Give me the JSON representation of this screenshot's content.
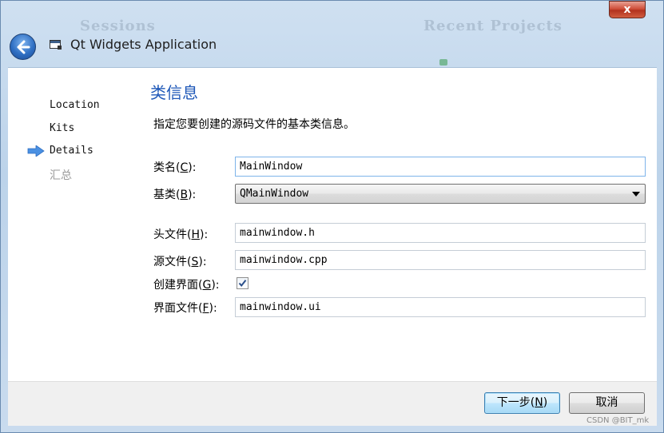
{
  "window": {
    "title": "Qt Widgets Application",
    "close_symbol": "x",
    "background_left": "Sessions",
    "background_right": "Recent Projects"
  },
  "steps": [
    {
      "label": "Location",
      "state": "done"
    },
    {
      "label": "Kits",
      "state": "done"
    },
    {
      "label": "Details",
      "state": "current"
    },
    {
      "label": "汇总",
      "state": "pending"
    }
  ],
  "page": {
    "title": "类信息",
    "description": "指定您要创建的源码文件的基本类信息。"
  },
  "form": {
    "class_name": {
      "label_pre": "类名(",
      "mnemonic": "C",
      "label_post": "):",
      "value": "MainWindow"
    },
    "base_class": {
      "label_pre": "基类(",
      "mnemonic": "B",
      "label_post": "):",
      "value": "QMainWindow"
    },
    "header_file": {
      "label_pre": "头文件(",
      "mnemonic": "H",
      "label_post": "):",
      "value": "mainwindow.h"
    },
    "source_file": {
      "label_pre": "源文件(",
      "mnemonic": "S",
      "label_post": "):",
      "value": "mainwindow.cpp"
    },
    "generate_form": {
      "label_pre": "创建界面(",
      "mnemonic": "G",
      "label_post": "):",
      "checked": true
    },
    "form_file": {
      "label_pre": "界面文件(",
      "mnemonic": "F",
      "label_post": "):",
      "value": "mainwindow.ui"
    }
  },
  "buttons": {
    "next": {
      "label_pre": "下一步(",
      "mnemonic": "N",
      "label_post": ")"
    },
    "cancel": "取消"
  },
  "watermark": "CSDN @BIT_mk",
  "icons": {
    "back": "back-arrow-icon",
    "title": "qt-widgets-window-icon",
    "current_step": "current-step-arrow-icon",
    "dropdown": "chevron-down-icon",
    "check": "checkmark-icon"
  },
  "colors": {
    "title_blue": "#1f58b8",
    "step_arrow": "#4a90e2",
    "close_red": "#c8452f"
  }
}
